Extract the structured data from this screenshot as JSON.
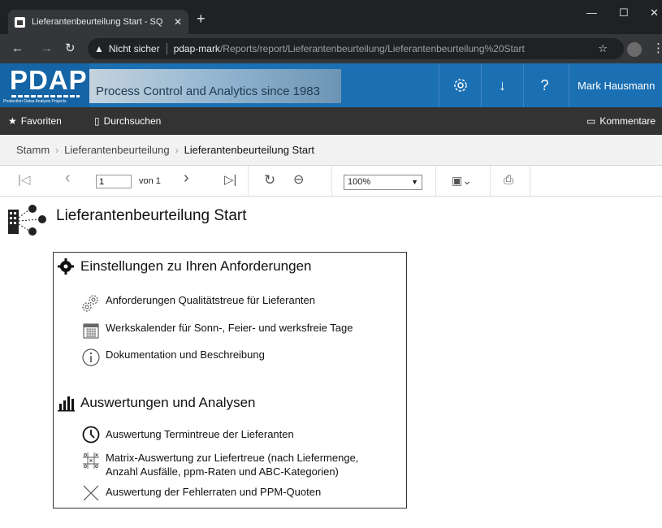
{
  "browser": {
    "tab_title": "Lieferantenbeurteilung Start - SQ",
    "security_label": "Nicht sicher",
    "url_host": "pdap-mark",
    "url_path": "/Reports/report/Lieferantenbeurteilung/Lieferantenbeurteilung%20Start"
  },
  "app": {
    "logo_text": "PDAP",
    "logo_tagline": "Production Datas Analysis Projects",
    "banner_text": "Process Control and Analytics since 1983",
    "user_name": "Mark Hausmann"
  },
  "menubar": {
    "favorites": "Favoriten",
    "browse": "Durchsuchen",
    "comments": "Kommentare"
  },
  "breadcrumb": {
    "items": [
      "Stamm",
      "Lieferantenbeurteilung",
      "Lieferantenbeurteilung Start"
    ]
  },
  "toolbar": {
    "page_value": "1",
    "of_label": "von 1",
    "zoom_value": "100%"
  },
  "report": {
    "title": "Lieferantenbeurteilung Start",
    "section1": {
      "heading": "Einstellungen zu Ihren Anforderungen",
      "items": [
        "Anforderungen Qualitätstreue für Lieferanten",
        "Werkskalender für Sonn-, Feier- und werksfreie Tage",
        "Dokumentation und Beschreibung"
      ]
    },
    "section2": {
      "heading": "Auswertungen und Analysen",
      "items": [
        "Auswertung Termintreue der Lieferanten",
        "Matrix-Auswertung zur Liefertreue (nach Liefermenge,",
        "Anzahl Ausfälle, ppm-Raten und ABC-Kategorien)",
        "Auswertung der Fehlerraten und PPM-Quoten"
      ]
    }
  },
  "colors": {
    "header_blue": "#1b6fb3",
    "dark_bar": "#333333",
    "browser_dark": "#202124"
  }
}
